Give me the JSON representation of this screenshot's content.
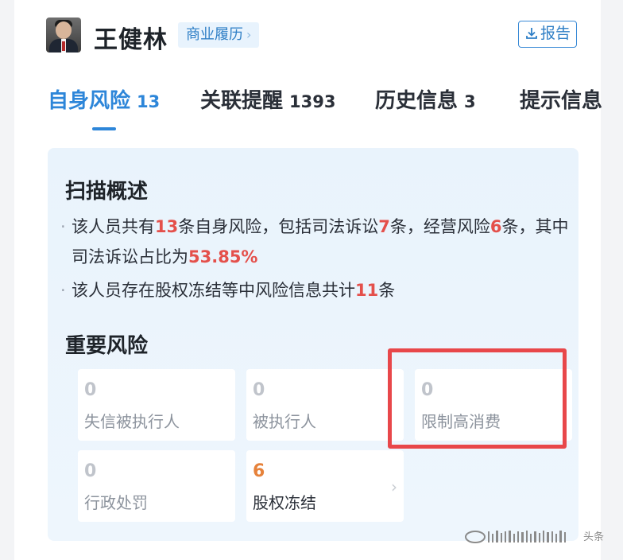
{
  "header": {
    "person_name": "王健林",
    "resume_tag": "商业履历",
    "report_button": "报告"
  },
  "tabs": [
    {
      "label": "自身风险",
      "count": "13",
      "active": true
    },
    {
      "label": "关联提醒",
      "count": "1393",
      "active": false
    },
    {
      "label": "历史信息",
      "count": "3",
      "active": false
    },
    {
      "label": "提示信息",
      "count": "",
      "active": false
    }
  ],
  "scan": {
    "title": "扫描概述",
    "line1": {
      "a": "该人员共有",
      "n1": "13",
      "b": "条自身风险，包括司法诉讼",
      "n2": "7",
      "c": "条，经营风险",
      "n3": "6",
      "d": "条，其中司法诉讼占比为",
      "n4": "53.85%"
    },
    "line2": {
      "a": "该人员存在股权冻结等中风险信息共计",
      "n1": "11",
      "b": "条"
    }
  },
  "important": {
    "title": "重要风险",
    "items": [
      {
        "count": "0",
        "label": "失信被执行人"
      },
      {
        "count": "0",
        "label": "被执行人"
      },
      {
        "count": "0",
        "label": "限制高消费"
      },
      {
        "count": "0",
        "label": "行政处罚"
      },
      {
        "count": "6",
        "label": "股权冻结"
      }
    ]
  },
  "colors": {
    "accent": "#2d86d9",
    "risk_red": "#e4504b",
    "count_orange": "#e6823b",
    "highlight_box": "#e8474a"
  },
  "icons": {
    "report": "download-icon",
    "resume_chevron": "chevron-right-icon",
    "tile_chevron": "chevron-right-icon"
  },
  "watermark": "头条"
}
